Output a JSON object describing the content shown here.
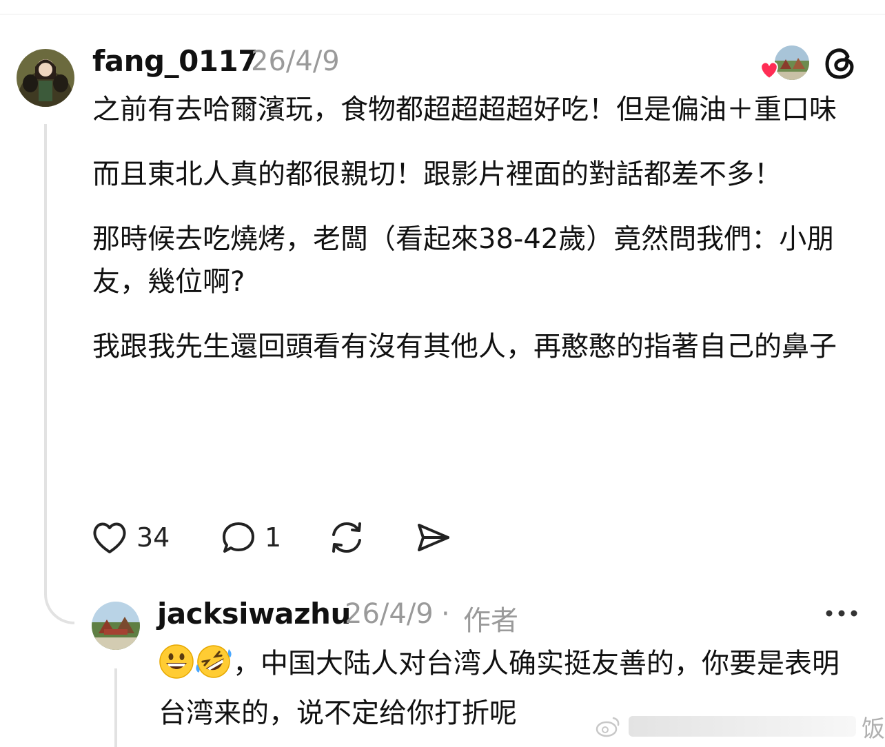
{
  "post": {
    "username": "fang_0117",
    "date": "26/4/9",
    "paragraphs": [
      "之前有去哈爾濱玩，食物都超超超超好吃！但是偏油＋重口味",
      "而且東北人真的都很親切！跟影片裡面的對話都差不多！",
      "那時候去吃燒烤，老闆（看起來38-42歲）竟然問我們：小朋友，幾位啊?",
      "我跟我先生還回頭看有沒有其他人，再憨憨的指著自己的鼻子"
    ],
    "likes": "34",
    "replies": "1"
  },
  "reply": {
    "username": "jacksiwazhu",
    "date": "26/4/9",
    "separator": "·",
    "author_badge": "作者",
    "text": "，中国大陆人对台湾人确实挺友善的，你要是表明台湾来的，说不定给你打折呢"
  },
  "icons": {
    "like": "heart-outline-icon",
    "reply": "speech-bubble-icon",
    "repost": "repost-icon",
    "share": "send-icon",
    "threads": "threads-logo-icon",
    "more": "ellipsis-icon",
    "emoji_1": "grinning-face-emoji",
    "emoji_2": "rolling-on-floor-laughing-emoji"
  },
  "colors": {
    "text": "#111111",
    "muted": "#9a9a9a",
    "divider": "#e2e2e2",
    "heart": "#ff2d55"
  },
  "watermark": {
    "text": "饭"
  }
}
